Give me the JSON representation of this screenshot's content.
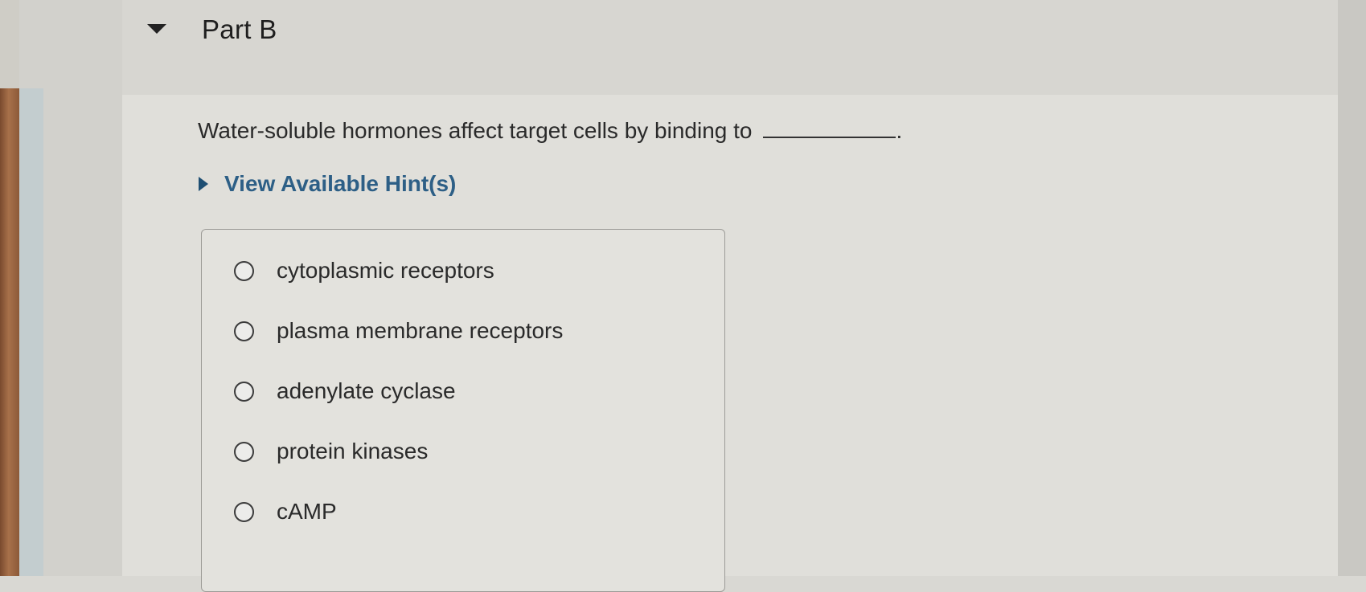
{
  "part": {
    "title": "Part B"
  },
  "question": {
    "text": "Water-soluble hormones affect target cells by binding to",
    "end": "."
  },
  "hint": {
    "label": "View Available Hint(s)"
  },
  "options": [
    {
      "label": "cytoplasmic receptors"
    },
    {
      "label": "plasma membrane receptors"
    },
    {
      "label": "adenylate cyclase"
    },
    {
      "label": "protein kinases"
    },
    {
      "label": "cAMP"
    }
  ],
  "colors": {
    "hint": "#2d5f86",
    "text": "#2a2a2a",
    "background": "#e0dfda"
  }
}
